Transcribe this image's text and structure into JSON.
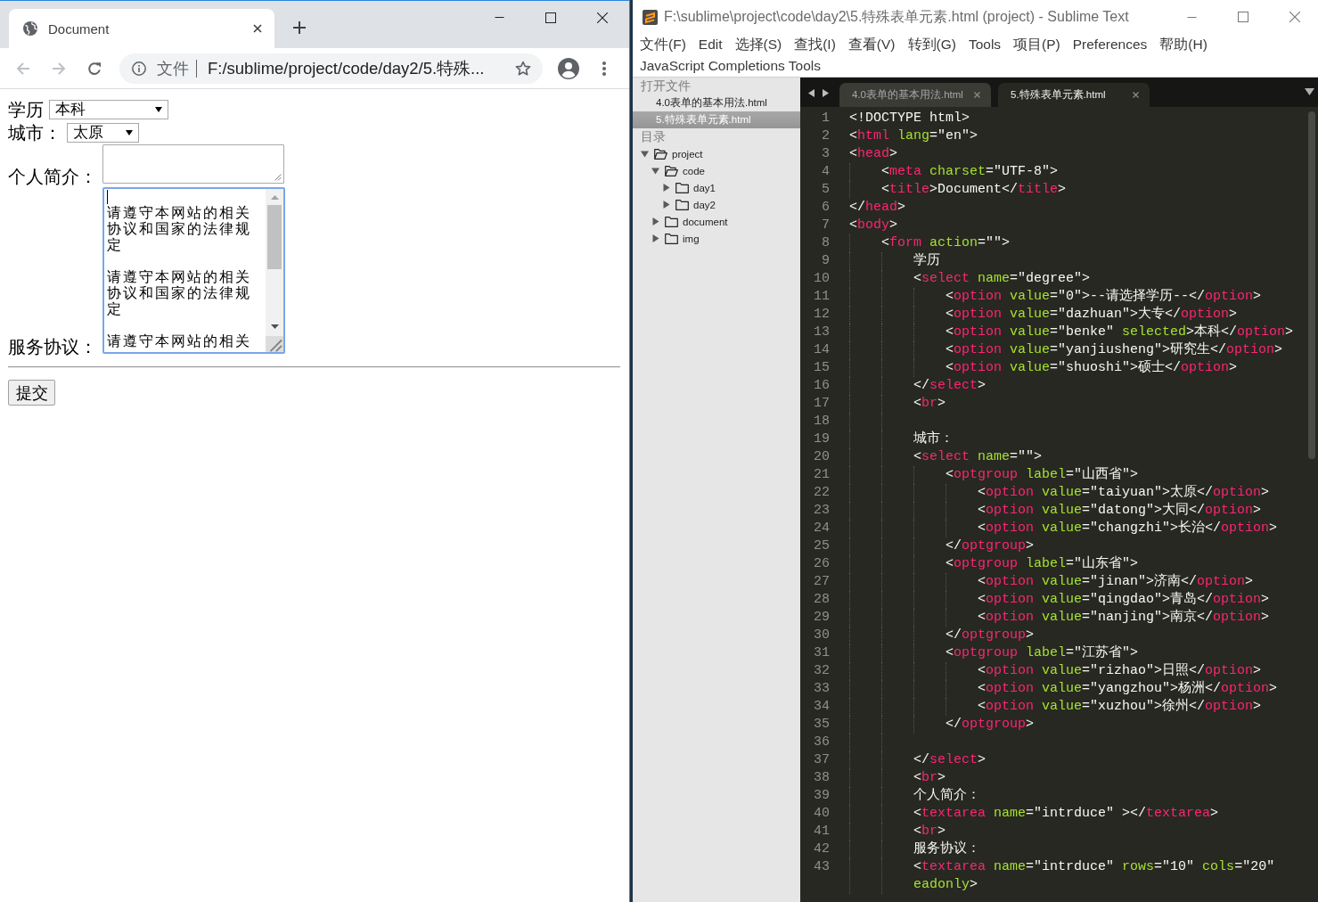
{
  "browser": {
    "tabs": [
      {
        "title": "Document",
        "selected": true
      }
    ],
    "back": {
      "disabled": true
    },
    "forward": {
      "disabled": true
    },
    "address_bar": {
      "scheme": "文件",
      "url": "F:/sublime/project/code/day2/5.特殊..."
    }
  },
  "page": {
    "fields": [
      {
        "kind": "select",
        "label": "学历",
        "value": "本科"
      },
      {
        "kind": "select",
        "label": "城市：",
        "value": "太原"
      },
      {
        "kind": "textarea",
        "label": "个人简介：",
        "focused": false
      },
      {
        "kind": "textarea",
        "label": "服务协议：",
        "focused": true,
        "paragraphs": [
          "请遵守本网站的相关协议和国家的法律规定",
          "请遵守本网站的相关协议和国家的法律规定",
          "请遵守本网站的相关"
        ]
      }
    ],
    "submit_button": "提交"
  },
  "editor_window": {
    "title": "F:\\sublime\\project\\code\\day2\\5.特殊表单元素.html (project) - Sublime Text",
    "menu": [
      "文件(F)",
      "Edit",
      "选择(S)",
      "查找(I)",
      "查看(V)",
      "转到(G)",
      "Tools",
      "项目(P)",
      "Preferences",
      "帮助(H)",
      "JavaScript Completions Tools"
    ],
    "sidebar": {
      "open_files_title": "打开文件",
      "open_files": [
        {
          "name": "4.0表单的基本用法.html",
          "selected": false
        },
        {
          "name": "5.特殊表单元素.html",
          "selected": true
        }
      ],
      "folders_title": "目录",
      "folders": [
        {
          "name": "project",
          "expanded": true,
          "children": [
            {
              "name": "code",
              "expanded": true,
              "children": [
                {
                  "name": "day1",
                  "expanded": false
                },
                {
                  "name": "day2",
                  "expanded": false
                }
              ]
            },
            {
              "name": "document",
              "expanded": false
            },
            {
              "name": "img",
              "expanded": false
            }
          ]
        }
      ]
    },
    "tabs": [
      {
        "title": "4.0表单的基本用法.html",
        "selected": false
      },
      {
        "title": "5.特殊表单元素.html",
        "selected": true
      }
    ],
    "lines": [
      {
        "number": "1",
        "tokens": [
          {
            "kind": "plain",
            "text": "<!DOCTYPE html>"
          }
        ]
      },
      {
        "number": "2",
        "tokens": [
          {
            "kind": "plain",
            "text": "<"
          },
          {
            "kind": "tag",
            "text": "html"
          },
          {
            "kind": "attr",
            "text": " lang"
          },
          {
            "kind": "plain",
            "text": "=\"en\">"
          }
        ]
      },
      {
        "number": "3",
        "tokens": [
          {
            "kind": "plain",
            "text": "<"
          },
          {
            "kind": "tag",
            "text": "head"
          },
          {
            "kind": "plain",
            "text": ">"
          }
        ],
        "children": [
          {
            "number": "4",
            "tokens": [
              {
                "kind": "plain",
                "text": "<"
              },
              {
                "kind": "tag",
                "text": "meta"
              },
              {
                "kind": "attr",
                "text": " charset"
              },
              {
                "kind": "plain",
                "text": "=\"UTF-8\">"
              }
            ]
          },
          {
            "number": "5",
            "tokens": [
              {
                "kind": "plain",
                "text": "<"
              },
              {
                "kind": "tag",
                "text": "title"
              },
              {
                "kind": "plain",
                "text": ">Document</"
              },
              {
                "kind": "tag",
                "text": "title"
              },
              {
                "kind": "plain",
                "text": ">"
              }
            ]
          }
        ]
      },
      {
        "number": "6",
        "tokens": [
          {
            "kind": "plain",
            "text": "</"
          },
          {
            "kind": "tag",
            "text": "head"
          },
          {
            "kind": "plain",
            "text": ">"
          }
        ]
      },
      {
        "number": "7",
        "tokens": [
          {
            "kind": "plain",
            "text": "<"
          },
          {
            "kind": "tag",
            "text": "body"
          },
          {
            "kind": "plain",
            "text": ">"
          }
        ],
        "children": [
          {
            "number": "8",
            "tokens": [
              {
                "kind": "plain",
                "text": "<"
              },
              {
                "kind": "tag",
                "text": "form"
              },
              {
                "kind": "attr",
                "text": " action"
              },
              {
                "kind": "plain",
                "text": "=\"\">"
              }
            ],
            "children": [
              {
                "number": "9",
                "tokens": [
                  {
                    "kind": "plain",
                    "text": "学历"
                  }
                ]
              },
              {
                "number": "10",
                "tokens": [
                  {
                    "kind": "plain",
                    "text": "<"
                  },
                  {
                    "kind": "tag",
                    "text": "select"
                  },
                  {
                    "kind": "attr",
                    "text": " name"
                  },
                  {
                    "kind": "plain",
                    "text": "=\"degree\">"
                  }
                ],
                "children": [
                  {
                    "number": "11",
                    "tokens": [
                      {
                        "kind": "plain",
                        "text": "<"
                      },
                      {
                        "kind": "tag",
                        "text": "option"
                      },
                      {
                        "kind": "attr",
                        "text": " value"
                      },
                      {
                        "kind": "plain",
                        "text": "=\"0\">--请选择学历--</"
                      },
                      {
                        "kind": "tag",
                        "text": "option"
                      },
                      {
                        "kind": "plain",
                        "text": ">"
                      }
                    ]
                  },
                  {
                    "number": "12",
                    "tokens": [
                      {
                        "kind": "plain",
                        "text": "<"
                      },
                      {
                        "kind": "tag",
                        "text": "option"
                      },
                      {
                        "kind": "attr",
                        "text": " value"
                      },
                      {
                        "kind": "plain",
                        "text": "=\"dazhuan\">大专</"
                      },
                      {
                        "kind": "tag",
                        "text": "option"
                      },
                      {
                        "kind": "plain",
                        "text": ">"
                      }
                    ]
                  },
                  {
                    "number": "13",
                    "tokens": [
                      {
                        "kind": "plain",
                        "text": "<"
                      },
                      {
                        "kind": "tag",
                        "text": "option"
                      },
                      {
                        "kind": "attr",
                        "text": " value"
                      },
                      {
                        "kind": "plain",
                        "text": "=\"benke\""
                      },
                      {
                        "kind": "attr",
                        "text": " selected"
                      },
                      {
                        "kind": "plain",
                        "text": ">本科</"
                      },
                      {
                        "kind": "tag",
                        "text": "option"
                      },
                      {
                        "kind": "plain",
                        "text": ">"
                      }
                    ]
                  },
                  {
                    "number": "14",
                    "tokens": [
                      {
                        "kind": "plain",
                        "text": "<"
                      },
                      {
                        "kind": "tag",
                        "text": "option"
                      },
                      {
                        "kind": "attr",
                        "text": " value"
                      },
                      {
                        "kind": "plain",
                        "text": "=\"yanjiusheng\">研究生</"
                      },
                      {
                        "kind": "tag",
                        "text": "option"
                      },
                      {
                        "kind": "plain",
                        "text": ">"
                      }
                    ]
                  },
                  {
                    "number": "15",
                    "tokens": [
                      {
                        "kind": "plain",
                        "text": "<"
                      },
                      {
                        "kind": "tag",
                        "text": "option"
                      },
                      {
                        "kind": "attr",
                        "text": " value"
                      },
                      {
                        "kind": "plain",
                        "text": "=\"shuoshi\">硕士</"
                      },
                      {
                        "kind": "tag",
                        "text": "option"
                      },
                      {
                        "kind": "plain",
                        "text": ">"
                      }
                    ]
                  }
                ]
              },
              {
                "number": "16",
                "tokens": [
                  {
                    "kind": "plain",
                    "text": "</"
                  },
                  {
                    "kind": "tag",
                    "text": "select"
                  },
                  {
                    "kind": "plain",
                    "text": ">"
                  }
                ]
              },
              {
                "number": "17",
                "tokens": [
                  {
                    "kind": "plain",
                    "text": "<"
                  },
                  {
                    "kind": "tag",
                    "text": "br"
                  },
                  {
                    "kind": "plain",
                    "text": ">"
                  }
                ]
              },
              {
                "number": "18"
              },
              {
                "number": "19",
                "tokens": [
                  {
                    "kind": "plain",
                    "text": "城市："
                  }
                ]
              },
              {
                "number": "20",
                "tokens": [
                  {
                    "kind": "plain",
                    "text": "<"
                  },
                  {
                    "kind": "tag",
                    "text": "select"
                  },
                  {
                    "kind": "attr",
                    "text": " name"
                  },
                  {
                    "kind": "plain",
                    "text": "=\"\">"
                  }
                ],
                "children": [
                  {
                    "number": "21",
                    "tokens": [
                      {
                        "kind": "plain",
                        "text": "<"
                      },
                      {
                        "kind": "tag",
                        "text": "optgroup"
                      },
                      {
                        "kind": "attr",
                        "text": " label"
                      },
                      {
                        "kind": "plain",
                        "text": "=\"山西省\">"
                      }
                    ],
                    "children": [
                      {
                        "number": "22",
                        "tokens": [
                          {
                            "kind": "plain",
                            "text": "<"
                          },
                          {
                            "kind": "tag",
                            "text": "option"
                          },
                          {
                            "kind": "attr",
                            "text": " value"
                          },
                          {
                            "kind": "plain",
                            "text": "=\"taiyuan\">太原</"
                          },
                          {
                            "kind": "tag",
                            "text": "option"
                          },
                          {
                            "kind": "plain",
                            "text": ">"
                          }
                        ]
                      },
                      {
                        "number": "23",
                        "tokens": [
                          {
                            "kind": "plain",
                            "text": "<"
                          },
                          {
                            "kind": "tag",
                            "text": "option"
                          },
                          {
                            "kind": "attr",
                            "text": " value"
                          },
                          {
                            "kind": "plain",
                            "text": "=\"datong\">大同</"
                          },
                          {
                            "kind": "tag",
                            "text": "option"
                          },
                          {
                            "kind": "plain",
                            "text": ">"
                          }
                        ]
                      },
                      {
                        "number": "24",
                        "tokens": [
                          {
                            "kind": "plain",
                            "text": "<"
                          },
                          {
                            "kind": "tag",
                            "text": "option"
                          },
                          {
                            "kind": "attr",
                            "text": " value"
                          },
                          {
                            "kind": "plain",
                            "text": "=\"changzhi\">长治</"
                          },
                          {
                            "kind": "tag",
                            "text": "option"
                          },
                          {
                            "kind": "plain",
                            "text": ">"
                          }
                        ]
                      }
                    ]
                  },
                  {
                    "number": "25",
                    "tokens": [
                      {
                        "kind": "plain",
                        "text": "</"
                      },
                      {
                        "kind": "tag",
                        "text": "optgroup"
                      },
                      {
                        "kind": "plain",
                        "text": ">"
                      }
                    ]
                  },
                  {
                    "number": "26",
                    "tokens": [
                      {
                        "kind": "plain",
                        "text": "<"
                      },
                      {
                        "kind": "tag",
                        "text": "optgroup"
                      },
                      {
                        "kind": "attr",
                        "text": " label"
                      },
                      {
                        "kind": "plain",
                        "text": "=\"山东省\">"
                      }
                    ],
                    "children": [
                      {
                        "number": "27",
                        "tokens": [
                          {
                            "kind": "plain",
                            "text": "<"
                          },
                          {
                            "kind": "tag",
                            "text": "option"
                          },
                          {
                            "kind": "attr",
                            "text": " value"
                          },
                          {
                            "kind": "plain",
                            "text": "=\"jinan\">济南</"
                          },
                          {
                            "kind": "tag",
                            "text": "option"
                          },
                          {
                            "kind": "plain",
                            "text": ">"
                          }
                        ]
                      },
                      {
                        "number": "28",
                        "tokens": [
                          {
                            "kind": "plain",
                            "text": "<"
                          },
                          {
                            "kind": "tag",
                            "text": "option"
                          },
                          {
                            "kind": "attr",
                            "text": " value"
                          },
                          {
                            "kind": "plain",
                            "text": "=\"qingdao\">青岛</"
                          },
                          {
                            "kind": "tag",
                            "text": "option"
                          },
                          {
                            "kind": "plain",
                            "text": ">"
                          }
                        ]
                      },
                      {
                        "number": "29",
                        "tokens": [
                          {
                            "kind": "plain",
                            "text": "<"
                          },
                          {
                            "kind": "tag",
                            "text": "option"
                          },
                          {
                            "kind": "attr",
                            "text": " value"
                          },
                          {
                            "kind": "plain",
                            "text": "=\"nanjing\">南京</"
                          },
                          {
                            "kind": "tag",
                            "text": "option"
                          },
                          {
                            "kind": "plain",
                            "text": ">"
                          }
                        ]
                      }
                    ]
                  },
                  {
                    "number": "30",
                    "tokens": [
                      {
                        "kind": "plain",
                        "text": "</"
                      },
                      {
                        "kind": "tag",
                        "text": "optgroup"
                      },
                      {
                        "kind": "plain",
                        "text": ">"
                      }
                    ]
                  },
                  {
                    "number": "31",
                    "tokens": [
                      {
                        "kind": "plain",
                        "text": "<"
                      },
                      {
                        "kind": "tag",
                        "text": "optgroup"
                      },
                      {
                        "kind": "attr",
                        "text": " label"
                      },
                      {
                        "kind": "plain",
                        "text": "=\"江苏省\">"
                      }
                    ],
                    "children": [
                      {
                        "number": "32",
                        "tokens": [
                          {
                            "kind": "plain",
                            "text": "<"
                          },
                          {
                            "kind": "tag",
                            "text": "option"
                          },
                          {
                            "kind": "attr",
                            "text": " value"
                          },
                          {
                            "kind": "plain",
                            "text": "=\"rizhao\">日照</"
                          },
                          {
                            "kind": "tag",
                            "text": "option"
                          },
                          {
                            "kind": "plain",
                            "text": ">"
                          }
                        ]
                      },
                      {
                        "number": "33",
                        "tokens": [
                          {
                            "kind": "plain",
                            "text": "<"
                          },
                          {
                            "kind": "tag",
                            "text": "option"
                          },
                          {
                            "kind": "attr",
                            "text": " value"
                          },
                          {
                            "kind": "plain",
                            "text": "=\"yangzhou\">杨洲</"
                          },
                          {
                            "kind": "tag",
                            "text": "option"
                          },
                          {
                            "kind": "plain",
                            "text": ">"
                          }
                        ]
                      },
                      {
                        "number": "34",
                        "tokens": [
                          {
                            "kind": "plain",
                            "text": "<"
                          },
                          {
                            "kind": "tag",
                            "text": "option"
                          },
                          {
                            "kind": "attr",
                            "text": " value"
                          },
                          {
                            "kind": "plain",
                            "text": "=\"xuzhou\">徐州</"
                          },
                          {
                            "kind": "tag",
                            "text": "option"
                          },
                          {
                            "kind": "plain",
                            "text": ">"
                          }
                        ]
                      }
                    ]
                  },
                  {
                    "number": "35",
                    "tokens": [
                      {
                        "kind": "plain",
                        "text": "</"
                      },
                      {
                        "kind": "tag",
                        "text": "optgroup"
                      },
                      {
                        "kind": "plain",
                        "text": ">"
                      }
                    ]
                  }
                ]
              },
              {
                "number": "36"
              },
              {
                "number": "37",
                "tokens": [
                  {
                    "kind": "plain",
                    "text": "</"
                  },
                  {
                    "kind": "tag",
                    "text": "select"
                  },
                  {
                    "kind": "plain",
                    "text": ">"
                  }
                ]
              },
              {
                "number": "38",
                "tokens": [
                  {
                    "kind": "plain",
                    "text": "<"
                  },
                  {
                    "kind": "tag",
                    "text": "br"
                  },
                  {
                    "kind": "plain",
                    "text": ">"
                  }
                ]
              },
              {
                "number": "39",
                "tokens": [
                  {
                    "kind": "plain",
                    "text": "个人简介："
                  }
                ]
              },
              {
                "number": "40",
                "tokens": [
                  {
                    "kind": "plain",
                    "text": "<"
                  },
                  {
                    "kind": "tag",
                    "text": "textarea"
                  },
                  {
                    "kind": "attr",
                    "text": " name"
                  },
                  {
                    "kind": "plain",
                    "text": "=\"intrduce\" ></"
                  },
                  {
                    "kind": "tag",
                    "text": "textarea"
                  },
                  {
                    "kind": "plain",
                    "text": ">"
                  }
                ]
              },
              {
                "number": "41",
                "tokens": [
                  {
                    "kind": "plain",
                    "text": "<"
                  },
                  {
                    "kind": "tag",
                    "text": "br"
                  },
                  {
                    "kind": "plain",
                    "text": ">"
                  }
                ]
              },
              {
                "number": "42",
                "tokens": [
                  {
                    "kind": "plain",
                    "text": "服务协议："
                  }
                ]
              },
              {
                "number": "43",
                "tokens": [
                  {
                    "kind": "plain",
                    "text": "<"
                  },
                  {
                    "kind": "tag",
                    "text": "textarea"
                  },
                  {
                    "kind": "attr",
                    "text": " name"
                  },
                  {
                    "kind": "plain",
                    "text": "=\"intrduce\""
                  },
                  {
                    "kind": "attr",
                    "text": " rows"
                  },
                  {
                    "kind": "plain",
                    "text": "=\"10\""
                  },
                  {
                    "kind": "attr",
                    "text": " cols"
                  },
                  {
                    "kind": "plain",
                    "text": "=\"20\""
                  }
                ],
                "wrapped": [
                  {
                    "kind": "attr",
                    "text": "eadonly"
                  },
                  {
                    "kind": "plain",
                    "text": ">"
                  }
                ]
              }
            ]
          }
        ]
      }
    ]
  }
}
